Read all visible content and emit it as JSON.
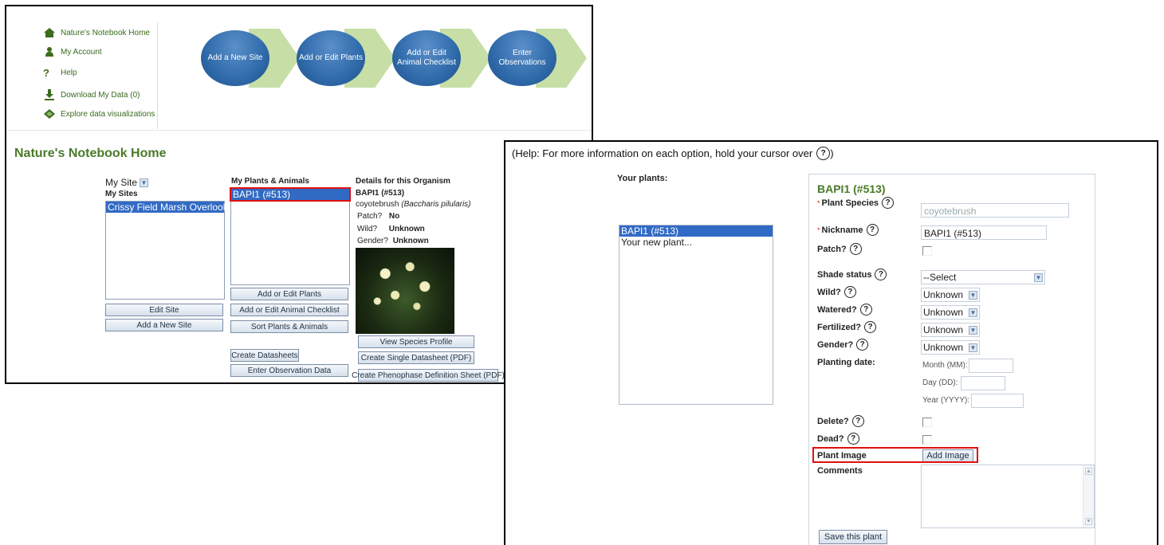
{
  "top_nav": {
    "quick_links": [
      {
        "label": "Nature's Notebook Home",
        "icon": "home-icon"
      },
      {
        "label": "My Account",
        "icon": "person-icon"
      },
      {
        "label": "Help",
        "icon": "question-icon"
      },
      {
        "label": "Download My Data (0)",
        "icon": "download-icon"
      },
      {
        "label": "Explore data visualizations",
        "icon": "visualization-icon"
      }
    ],
    "workflow_steps": [
      "Add a New Site",
      "Add or Edit Plants",
      "Add or Edit\nAnimal Checklist",
      "Enter\nObservations"
    ]
  },
  "home": {
    "title": "Nature's Notebook Home",
    "site_select": "My Site",
    "my_sites_header": "My Sites",
    "sites": [
      "Crissy Field Marsh Overlook"
    ],
    "plants_header": "My Plants & Animals",
    "plants": [
      "BAPI1 (#513)"
    ],
    "site_buttons": [
      "Edit Site",
      "Add a New Site"
    ],
    "plant_buttons": [
      "Add or Edit Plants",
      "Add or Edit Animal Checklist",
      "Sort Plants & Animals"
    ],
    "datasheet_buttons": [
      "Create Datasheets",
      "Enter Observation Data"
    ],
    "details": {
      "header": "Details for this Organism",
      "name": "BAPI1 (#513)",
      "species_common": "coyotebrush",
      "species_latin": "(Baccharis pilularis)",
      "patch_label": "Patch?",
      "patch_value": "No",
      "wild_label": "Wild?",
      "wild_value": "Unknown",
      "gender_label": "Gender?",
      "gender_value": "Unknown"
    },
    "detail_buttons": [
      "View Species Profile",
      "Create Single Datasheet (PDF)",
      "Create Phenophase Definition Sheet (PDF)"
    ]
  },
  "edit_plant": {
    "help_text": "(Help: For more information on each option, hold your cursor over",
    "help_suffix": ")",
    "your_plants_label": "Your plants:",
    "plant_list": [
      "BAPI1 (#513)",
      "Your new plant..."
    ],
    "form_title": "BAPI1 (#513)",
    "labels": {
      "species": "Plant Species",
      "nickname": "Nickname",
      "patch": "Patch?",
      "shade": "Shade status",
      "wild": "Wild?",
      "watered": "Watered?",
      "fertilized": "Fertilized?",
      "gender": "Gender?",
      "planting_date": "Planting date:",
      "delete": "Delete?",
      "dead": "Dead?",
      "plant_image": "Plant Image",
      "comments": "Comments"
    },
    "values": {
      "species": "coyotebrush",
      "nickname": "BAPI1 (#513)",
      "shade": "--Select",
      "wild": "Unknown",
      "watered": "Unknown",
      "fertilized": "Unknown",
      "gender": "Unknown"
    },
    "date_labels": [
      "Month (MM):",
      "Day (DD):",
      "Year (YYYY):"
    ],
    "add_image_button": "Add Image",
    "save_button": "Save this plant"
  },
  "colors": {
    "accent_green": "#4a7a28",
    "selection_blue": "#316ac5",
    "highlight_red": "#e01010",
    "oval_blue": "#2f6aaa",
    "arrow_green": "#c7dfa6"
  }
}
